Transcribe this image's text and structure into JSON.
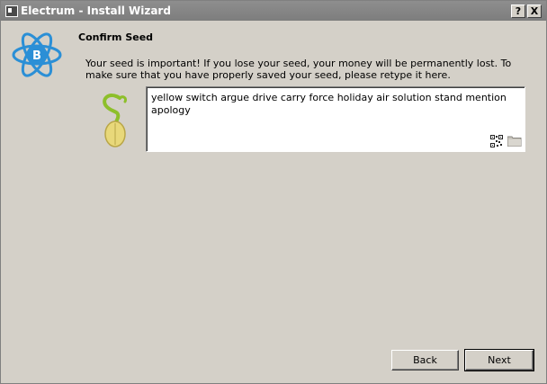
{
  "window": {
    "title": "Electrum  -  Install Wizard",
    "help_label": "?",
    "close_label": "X"
  },
  "page": {
    "heading": "Confirm Seed",
    "message": "Your seed is important! If you lose your seed, your money will be permanently lost. To make sure that you have properly saved your seed, please retype it here."
  },
  "seed": {
    "text": "yellow switch argue drive carry force holiday air solution stand mention apology"
  },
  "buttons": {
    "back": "Back",
    "next": "Next"
  },
  "colors": {
    "background": "#d4d0c8",
    "logo_blue": "#2b8fd6",
    "seed_yellow": "#e8d87a",
    "sprout_green": "#9ccf2f"
  },
  "icons": {
    "logo": "electrum-logo-icon",
    "seed": "seed-sprout-icon",
    "qr": "qr-code-icon",
    "folder": "folder-icon"
  }
}
